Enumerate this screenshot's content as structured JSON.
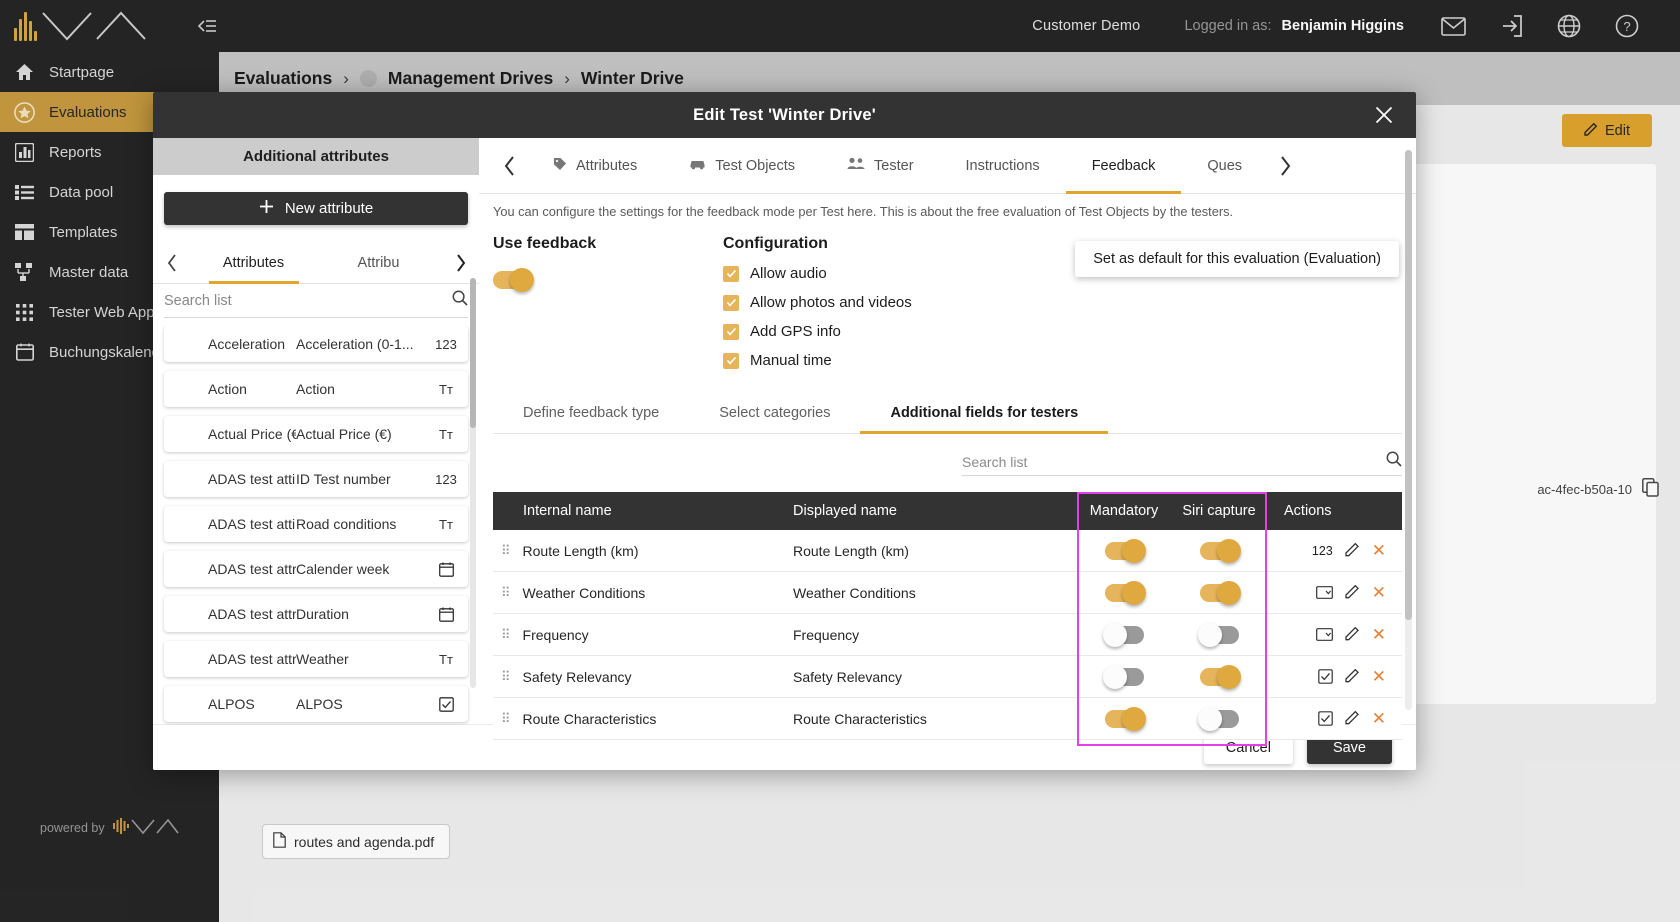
{
  "topbar": {
    "customer": "Customer Demo",
    "logged_in_label": "Logged in as:",
    "user": "Benjamin Higgins",
    "icons": [
      "mail-icon",
      "logout-icon",
      "language-icon",
      "help-icon"
    ]
  },
  "sidebar": {
    "items": [
      {
        "label": "Startpage",
        "icon": "home-icon",
        "active": false
      },
      {
        "label": "Evaluations",
        "icon": "star-icon",
        "active": true
      },
      {
        "label": "Reports",
        "icon": "chart-icon",
        "active": false
      },
      {
        "label": "Data pool",
        "icon": "database-icon",
        "active": false
      },
      {
        "label": "Templates",
        "icon": "layout-icon",
        "active": false
      },
      {
        "label": "Master data",
        "icon": "sitemap-icon",
        "active": false
      },
      {
        "label": "Tester Web Applic",
        "icon": "grid-icon",
        "active": false
      },
      {
        "label": "Buchungskalender",
        "icon": "calendar-icon",
        "active": false
      }
    ],
    "powered_by": "powered by"
  },
  "page": {
    "breadcrumb": [
      "Evaluations",
      "Management Drives",
      "Winter Drive"
    ],
    "edit_button": "Edit",
    "uuid_fragment": "ac-4fec-b50a-10",
    "attachment": "routes and agenda.pdf"
  },
  "modal": {
    "title": "Edit Test 'Winter Drive'",
    "close_icon": "close-icon",
    "attributes_pane": {
      "header": "Additional attributes",
      "new_attribute_button": "New attribute",
      "tabs": [
        {
          "label": "Attributes",
          "active": true
        },
        {
          "label": "Attribu",
          "active": false
        }
      ],
      "search_placeholder": "Search list",
      "search_value": "",
      "rows": [
        {
          "internal": "Acceleration",
          "displayed": "Acceleration (0-1...",
          "type": "123"
        },
        {
          "internal": "Action",
          "displayed": "Action",
          "type": "Tт"
        },
        {
          "internal": "Actual Price (€)",
          "displayed": "Actual Price (€)",
          "type": "Tт"
        },
        {
          "internal": "ADAS test attibu...",
          "displayed": "ID Test number",
          "type": "123"
        },
        {
          "internal": "ADAS test attibu...",
          "displayed": "Road conditions",
          "type": "Tт"
        },
        {
          "internal": "ADAS test attrib...",
          "displayed": "Calender week",
          "type": "calendar-icon"
        },
        {
          "internal": "ADAS test attrib...",
          "displayed": "Duration",
          "type": "calendar-icon"
        },
        {
          "internal": "ADAS test attrib...",
          "displayed": "Weather",
          "type": "Tт"
        },
        {
          "internal": "ALPOS",
          "displayed": "ALPOS",
          "type": "checkbox-icon"
        }
      ]
    },
    "main_tabs": [
      {
        "label": "Attributes",
        "icon": "tag-icon",
        "active": false
      },
      {
        "label": "Test Objects",
        "icon": "car-icon",
        "active": false
      },
      {
        "label": "Tester",
        "icon": "people-icon",
        "active": false
      },
      {
        "label": "Instructions",
        "icon": "",
        "active": false
      },
      {
        "label": "Feedback",
        "icon": "",
        "active": true
      },
      {
        "label": "Ques",
        "icon": "",
        "active": false
      }
    ],
    "hint": "You can configure the settings for the feedback mode per Test here. This is about the free evaluation of Test Objects by the testers.",
    "use_feedback": {
      "title": "Use feedback",
      "enabled": true
    },
    "configuration": {
      "title": "Configuration",
      "options": [
        {
          "label": "Allow audio",
          "checked": true
        },
        {
          "label": "Allow photos and videos",
          "checked": true
        },
        {
          "label": "Add GPS info",
          "checked": true
        },
        {
          "label": "Manual time",
          "checked": true
        }
      ]
    },
    "default_button": "Set as default for this evaluation (Evaluation)",
    "subtabs": [
      {
        "label": "Define feedback type",
        "active": false
      },
      {
        "label": "Select categories",
        "active": false
      },
      {
        "label": "Additional fields for testers",
        "active": true
      }
    ],
    "table_search_placeholder": "Search list",
    "table_search_value": "",
    "table": {
      "columns": [
        "Internal name",
        "Displayed name",
        "Mandatory",
        "Siri capture",
        "Actions"
      ],
      "rows": [
        {
          "internal": "Route Length (km)",
          "displayed": "Route Length (km)",
          "mandatory": true,
          "siri": true,
          "type": "123",
          "type_icon": "number-icon"
        },
        {
          "internal": "Weather Conditions",
          "displayed": "Weather Conditions",
          "mandatory": true,
          "siri": true,
          "type": "",
          "type_icon": "dropdown-icon"
        },
        {
          "internal": "Frequency",
          "displayed": "Frequency",
          "mandatory": false,
          "siri": false,
          "type": "",
          "type_icon": "dropdown-icon"
        },
        {
          "internal": "Safety Relevancy",
          "displayed": "Safety Relevancy",
          "mandatory": false,
          "siri": true,
          "type": "",
          "type_icon": "checkbox-icon"
        },
        {
          "internal": "Route Characteristics",
          "displayed": "Route Characteristics",
          "mandatory": true,
          "siri": false,
          "type": "",
          "type_icon": "checkbox-icon"
        }
      ],
      "highlight_color": "#e83ee8"
    },
    "footer": {
      "cancel": "Cancel",
      "save": "Save"
    }
  },
  "colors": {
    "accent": "#dfa52f",
    "dark": "#262626",
    "toggle_on": "#e0a93f",
    "highlight": "#e83ee8"
  }
}
